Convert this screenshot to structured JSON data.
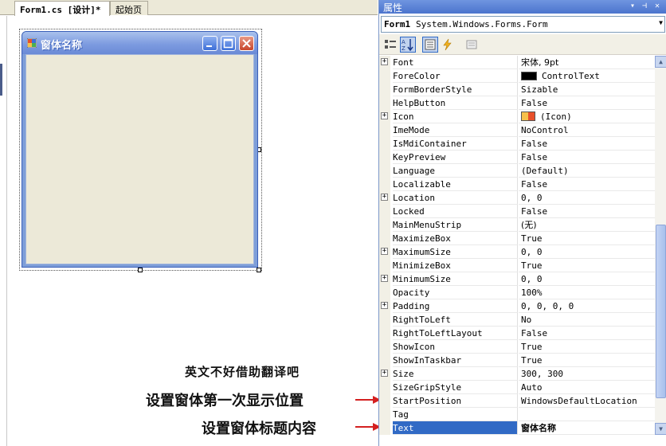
{
  "tabs": [
    {
      "label": "Form1.cs [设计]*"
    },
    {
      "label": "起始页"
    }
  ],
  "form": {
    "title": "窗体名称"
  },
  "properties": {
    "title": "属性",
    "object_name": "Form1",
    "object_type": "System.Windows.Forms.Form",
    "rows": [
      {
        "name": "Font",
        "value": "宋体, 9pt",
        "expandable": true
      },
      {
        "name": "ForeColor",
        "value": "ControlText",
        "swatch": "#000000"
      },
      {
        "name": "FormBorderStyle",
        "value": "Sizable"
      },
      {
        "name": "HelpButton",
        "value": "False"
      },
      {
        "name": "Icon",
        "value": "(Icon)",
        "expandable": true,
        "icon": "icon-swatch"
      },
      {
        "name": "ImeMode",
        "value": "NoControl"
      },
      {
        "name": "IsMdiContainer",
        "value": "False"
      },
      {
        "name": "KeyPreview",
        "value": "False"
      },
      {
        "name": "Language",
        "value": "(Default)"
      },
      {
        "name": "Localizable",
        "value": "False"
      },
      {
        "name": "Location",
        "value": "0, 0",
        "expandable": true
      },
      {
        "name": "Locked",
        "value": "False"
      },
      {
        "name": "MainMenuStrip",
        "value": "(无)"
      },
      {
        "name": "MaximizeBox",
        "value": "True"
      },
      {
        "name": "MaximumSize",
        "value": "0, 0",
        "expandable": true
      },
      {
        "name": "MinimizeBox",
        "value": "True"
      },
      {
        "name": "MinimumSize",
        "value": "0, 0",
        "expandable": true
      },
      {
        "name": "Opacity",
        "value": "100%"
      },
      {
        "name": "Padding",
        "value": "0, 0, 0, 0",
        "expandable": true
      },
      {
        "name": "RightToLeft",
        "value": "No"
      },
      {
        "name": "RightToLeftLayout",
        "value": "False"
      },
      {
        "name": "ShowIcon",
        "value": "True"
      },
      {
        "name": "ShowInTaskbar",
        "value": "True"
      },
      {
        "name": "Size",
        "value": "300, 300",
        "expandable": true
      },
      {
        "name": "SizeGripStyle",
        "value": "Auto"
      },
      {
        "name": "StartPosition",
        "value": "WindowsDefaultLocation"
      },
      {
        "name": "Tag",
        "value": ""
      },
      {
        "name": "Text",
        "value": "窗体名称",
        "selected": true
      }
    ]
  },
  "annotations": {
    "note_translate": "英文不好借助翻译吧",
    "note_start_position": "设置窗体第一次显示位置",
    "note_text": "设置窗体标题内容"
  },
  "colors": {
    "accent": "#316ac5",
    "arrow": "#d42020",
    "titlebar": "#7d9be0"
  }
}
